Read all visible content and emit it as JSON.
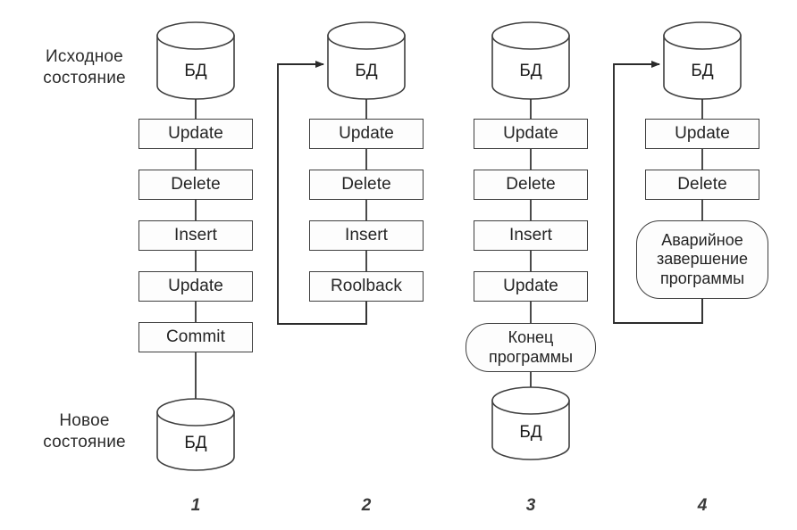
{
  "diagram": {
    "title_labels": {
      "initial_state": "Исходное\nсостояние",
      "new_state": "Новое\nсостояние"
    },
    "db_label": "БД",
    "columns": [
      {
        "number": "1",
        "top_db": "БД",
        "steps": [
          "Update",
          "Delete",
          "Insert",
          "Update",
          "Commit"
        ],
        "terminator": null,
        "bottom_db": "БД",
        "rollback_arrow": false
      },
      {
        "number": "2",
        "top_db": "БД",
        "steps": [
          "Update",
          "Delete",
          "Insert",
          "Roolback"
        ],
        "terminator": null,
        "bottom_db": null,
        "rollback_arrow": true
      },
      {
        "number": "3",
        "top_db": "БД",
        "steps": [
          "Update",
          "Delete",
          "Insert",
          "Update"
        ],
        "terminator": "Конец\nпрограммы",
        "bottom_db": "БД",
        "rollback_arrow": false
      },
      {
        "number": "4",
        "top_db": "БД",
        "steps": [
          "Update",
          "Delete"
        ],
        "terminator": "Аварийное\nзавершение\nпрограммы",
        "bottom_db": null,
        "rollback_arrow": true
      }
    ],
    "colors": {
      "stroke": "#3f3f3f",
      "text": "#242424",
      "background": "#ffffff"
    }
  }
}
